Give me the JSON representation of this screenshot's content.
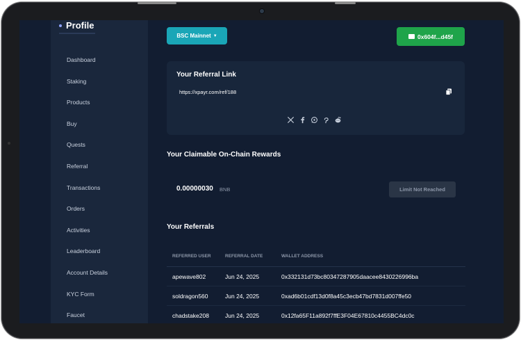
{
  "sidebar": {
    "title": "Profile",
    "items": [
      {
        "label": "Dashboard"
      },
      {
        "label": "Staking"
      },
      {
        "label": "Products"
      },
      {
        "label": "Buy"
      },
      {
        "label": "Quests"
      },
      {
        "label": "Referral"
      },
      {
        "label": "Transactions"
      },
      {
        "label": "Orders"
      },
      {
        "label": "Activities"
      },
      {
        "label": "Leaderboard"
      },
      {
        "label": "Account Details"
      },
      {
        "label": "KYC Form"
      },
      {
        "label": "Faucet"
      }
    ]
  },
  "header": {
    "network_label": "BSC Mainnet",
    "wallet_label": "0x604f...d45f"
  },
  "referral_link": {
    "title": "Your Referral Link",
    "url": "https://xpayr.com/ref/188",
    "share_icons": [
      "x-icon",
      "facebook-icon",
      "whatsapp-icon",
      "pinterest-icon",
      "reddit-icon"
    ]
  },
  "rewards": {
    "title": "Your Claimable On-Chain Rewards",
    "amount": "0.00000030",
    "unit": "BNB",
    "button_label": "Limit Not Reached"
  },
  "referrals": {
    "title": "Your Referrals",
    "columns": [
      "REFERRED USER",
      "REFERRAL DATE",
      "WALLET ADDRESS"
    ],
    "rows": [
      {
        "user": "apewave802",
        "date": "Jun 24, 2025",
        "wallet": "0x332131d73bc80347287905daacee8430226996ba"
      },
      {
        "user": "soldragon560",
        "date": "Jun 24, 2025",
        "wallet": "0xad6b01cdf13d0f8a45c3ecb47bd7831d007ffe50"
      },
      {
        "user": "chadstake208",
        "date": "Jun 24, 2025",
        "wallet": "0x12fa65F11a892f7ffE3F04E67810c4455BC4dc0c"
      }
    ]
  },
  "colors": {
    "background": "#121d31",
    "sidebar": "#1a273c",
    "network_button": "#1aa6b7",
    "wallet_button": "#1fa44a"
  }
}
